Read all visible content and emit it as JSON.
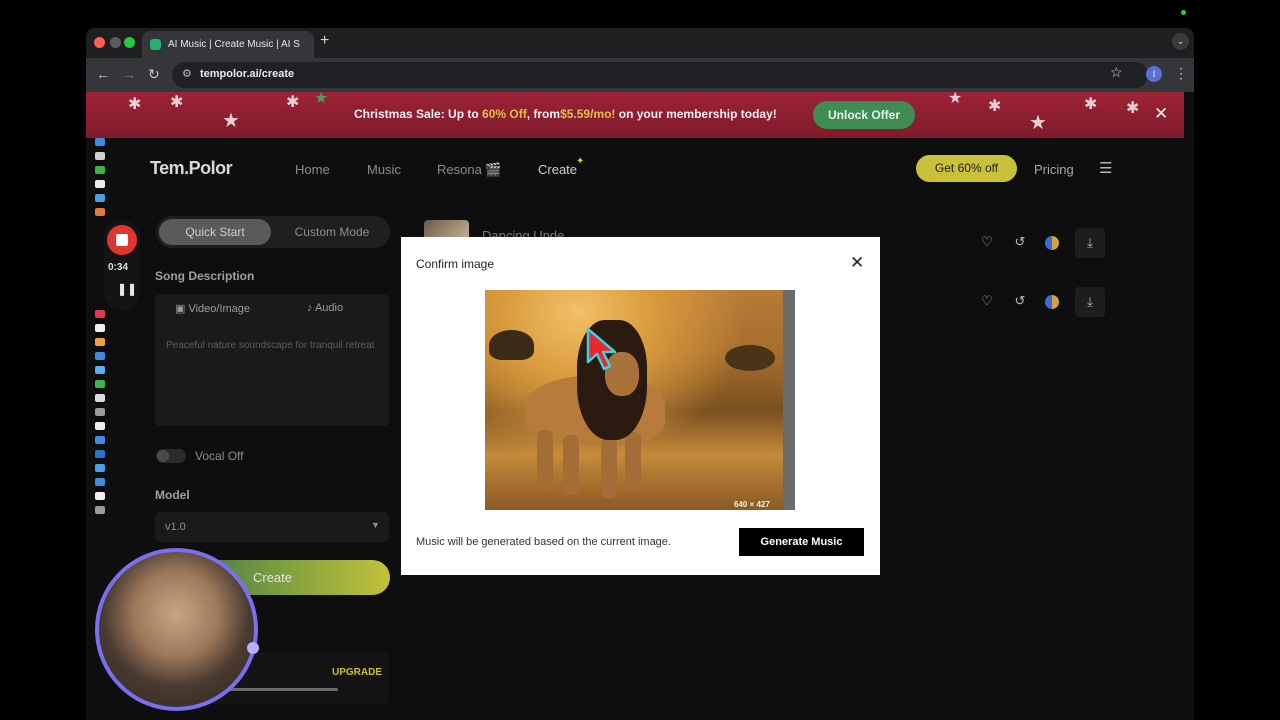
{
  "browser": {
    "tab_title": "AI Music | Create Music | AI S",
    "url": "tempolor.ai/create",
    "profile_initial": "I"
  },
  "promo": {
    "text_before": "Christmas Sale: Up to ",
    "discount": "60% Off",
    "text_mid": ", from",
    "price": "$5.59/mo!",
    "text_after": " on your membership today!",
    "cta": "Unlock Offer"
  },
  "header": {
    "logo": "Tem.Polor",
    "nav": [
      "Home",
      "Music",
      "Resona 🎬",
      "Create"
    ],
    "get_offer": "Get 60% off",
    "pricing": "Pricing"
  },
  "sidebar": {
    "modes": [
      "Quick Start",
      "Custom Mode"
    ],
    "song_description_label": "Song Description",
    "input_tabs": [
      "Video/Image",
      "Audio"
    ],
    "description_placeholder": "Peaceful nature soundscape for tranquil retreat",
    "vocal_label": "Vocal Off",
    "model_label": "Model",
    "model_value": "v1.0",
    "create_label": "Create",
    "upgrade_label": "UPGRADE"
  },
  "tracks": [
    {
      "title": "Dancing Unde"
    }
  ],
  "recorder": {
    "elapsed": "0:34"
  },
  "modal": {
    "title": "Confirm image",
    "image_dimensions": "640 × 427",
    "note": "Music will be generated based on the current image.",
    "generate_label": "Generate Music"
  },
  "colors": {
    "promo_bg": "#8f1f30",
    "accent_yellow": "#c9c13a",
    "offer_green": "#3f8c55",
    "record_red": "#e0362f"
  }
}
